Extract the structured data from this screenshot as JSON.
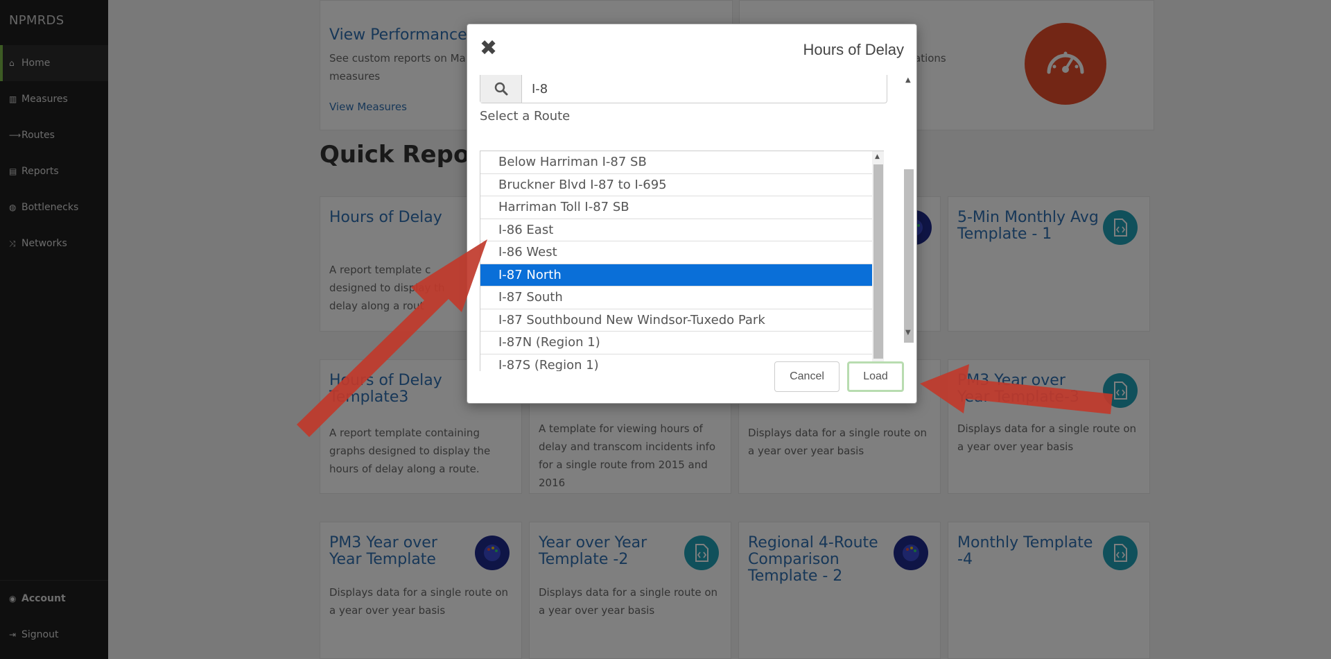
{
  "sidebar": {
    "brand": "NPMRDS",
    "items": [
      {
        "label": "Home",
        "icon": "home-icon",
        "active": true
      },
      {
        "label": "Measures",
        "icon": "bar-chart-icon"
      },
      {
        "label": "Routes",
        "icon": "arrow-right-icon"
      },
      {
        "label": "Reports",
        "icon": "document-icon"
      },
      {
        "label": "Bottlenecks",
        "icon": "palette-icon"
      },
      {
        "label": "Networks",
        "icon": "shuffle-icon"
      }
    ],
    "footer": [
      {
        "label": "Account",
        "icon": "user-circle-icon"
      },
      {
        "label": "Signout",
        "icon": "signout-icon"
      }
    ]
  },
  "background": {
    "performance": {
      "title": "View Performance",
      "desc": "See custom reports on Ma",
      "desc2": "measures",
      "link": "View Measures",
      "right_desc": "ations"
    },
    "section_title": "Quick Report",
    "cards": [
      {
        "title": "Hours of Delay",
        "desc": "A report template c",
        "desc2": "designed to display th",
        "desc3": "delay along a rout"
      },
      {
        "title": "5-Min Monthly Avg Template - 1",
        "desc": ""
      },
      {
        "title": "Hours of Delay Template3",
        "desc": "A report template containing graphs designed to display the hours of delay along a route."
      },
      {
        "title": "",
        "desc": "A template for viewing hours of delay and transcom incidents info for a single route from 2015 and 2016"
      },
      {
        "title": "",
        "desc": "Displays data for a single route on a year over year basis"
      },
      {
        "title": "PM3 Year over Year Template-3",
        "desc": "Displays data for a single route on a year over year basis"
      },
      {
        "title": "PM3 Year over Year Template",
        "desc": "Displays data for a single route on a year over year basis"
      },
      {
        "title": "Year over Year Template -2",
        "desc": "Displays data for a single route on a year over year basis"
      },
      {
        "title": "Regional 4-Route Comparison Template - 2",
        "desc": ""
      },
      {
        "title": "Monthly Template -4",
        "desc": ""
      }
    ],
    "fragment_a": "a",
    "colors": {
      "accent": "#2f6fb1",
      "gauge": "#e74c2a",
      "teal": "#21a0b6"
    }
  },
  "modal": {
    "title": "Hours of Delay",
    "search_value": "I-8",
    "route_label": "Select a Route",
    "routes": [
      "Below Harriman I-87 SB",
      "Bruckner Blvd I-87 to I-695",
      "Harriman Toll I-87 SB",
      "I-86 East",
      "I-86 West",
      "I-87 North",
      "I-87 South",
      "I-87 Southbound New Windsor-Tuxedo Park",
      "I-87N (Region 1)",
      "I-87S (Region 1)"
    ],
    "selected_route": "I-87 North",
    "cancel_label": "Cancel",
    "load_label": "Load",
    "colors": {
      "selected": "#0a6fd8",
      "load_border": "#b8dcb0",
      "annotation_arrow": "#c0392b"
    }
  }
}
